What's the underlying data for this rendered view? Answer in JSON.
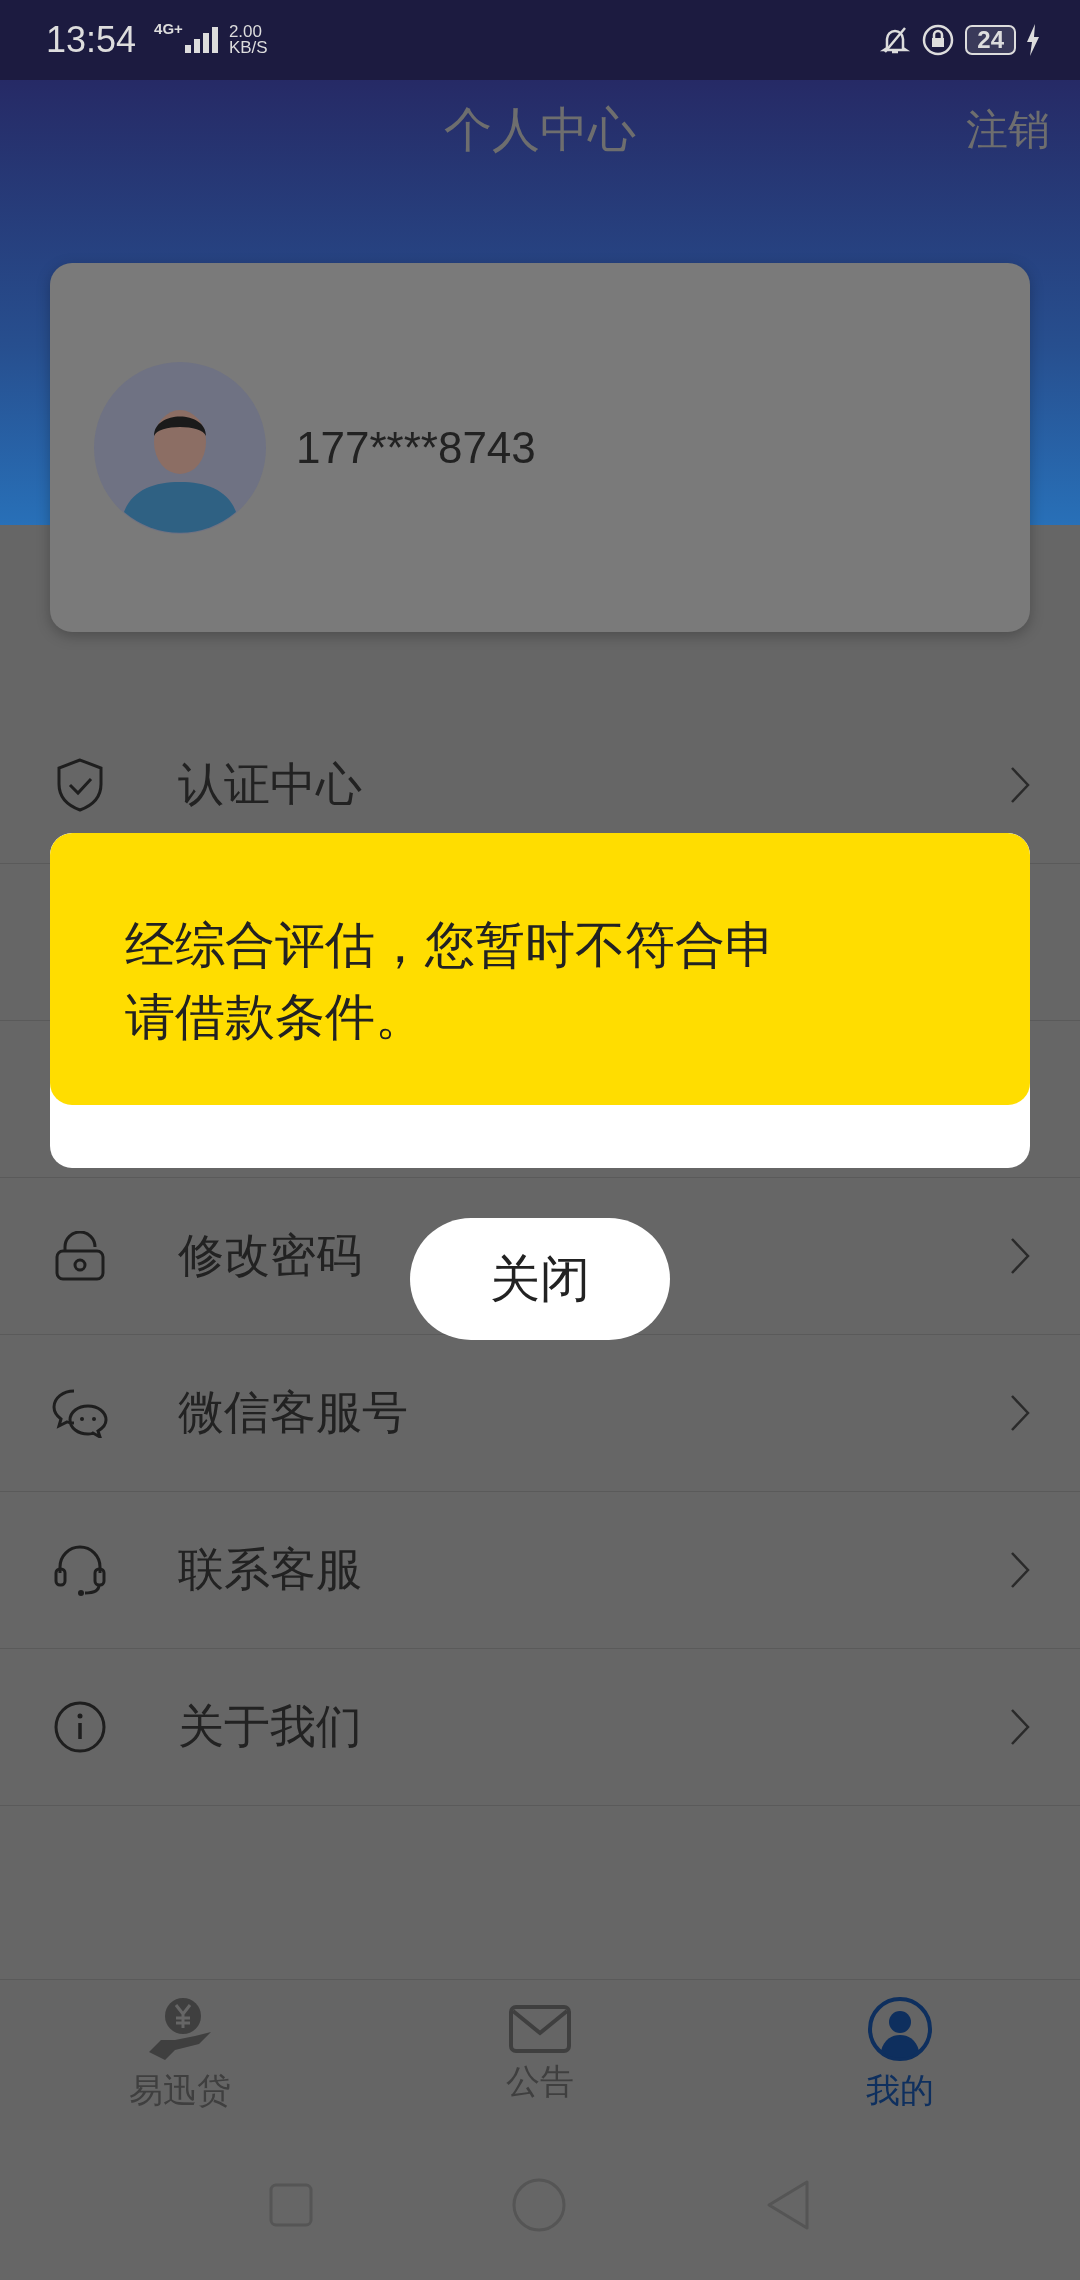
{
  "status_bar": {
    "time": "13:54",
    "network": "4G+",
    "speed": "2.00",
    "speed_unit": "KB/S",
    "battery": "24"
  },
  "header": {
    "title": "个人中心",
    "action": "注销"
  },
  "profile": {
    "phone": "177****8743"
  },
  "menu": [
    {
      "kind": "shield",
      "label": "认证中心"
    },
    {
      "kind": "hidden"
    },
    {
      "kind": "hidden"
    },
    {
      "kind": "lock",
      "label": "修改密码"
    },
    {
      "kind": "chat",
      "label": "微信客服号"
    },
    {
      "kind": "headset",
      "label": "联系客服"
    },
    {
      "kind": "info",
      "label": "关于我们"
    }
  ],
  "dialog": {
    "message": "经综合评估，您暂时不符合申请借款条件。",
    "close": "关闭"
  },
  "tabs": [
    {
      "kind": "loan",
      "label": "易迅贷",
      "selected": false
    },
    {
      "kind": "notice",
      "label": "公告",
      "selected": false
    },
    {
      "kind": "me",
      "label": "我的",
      "selected": true
    }
  ]
}
